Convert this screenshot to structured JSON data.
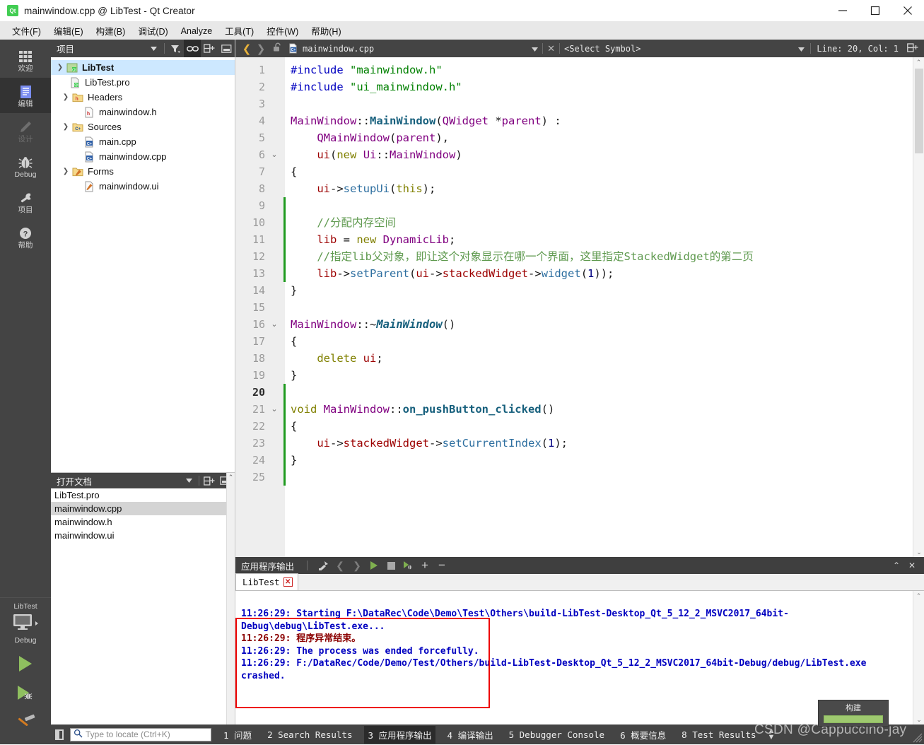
{
  "window": {
    "title": "mainwindow.cpp @ LibTest - Qt Creator",
    "logo_text": "Qt",
    "minimize": "–",
    "maximize": "□",
    "close": "✕"
  },
  "menubar": {
    "items": [
      {
        "label": "文件(F)"
      },
      {
        "label": "编辑(E)"
      },
      {
        "label": "构建(B)"
      },
      {
        "label": "调试(D)"
      },
      {
        "label": "Analyze"
      },
      {
        "label": "工具(T)"
      },
      {
        "label": "控件(W)"
      },
      {
        "label": "帮助(H)"
      }
    ]
  },
  "modebar": {
    "items": [
      {
        "label": "欢迎",
        "icon": "grid-icon",
        "state": "normal"
      },
      {
        "label": "编辑",
        "icon": "document-icon",
        "state": "active"
      },
      {
        "label": "设计",
        "icon": "pencil-icon",
        "state": "disabled"
      },
      {
        "label": "Debug",
        "icon": "bug-icon",
        "state": "normal"
      },
      {
        "label": "项目",
        "icon": "wrench-icon",
        "state": "normal"
      },
      {
        "label": "帮助",
        "icon": "question-icon",
        "state": "normal"
      }
    ]
  },
  "kit_selector": {
    "project_name": "LibTest",
    "build_config": "Debug",
    "run_button": "run-icon",
    "debug_button": "debug-run-icon",
    "build_button": "hammer-icon"
  },
  "project_panel": {
    "title": "项目",
    "toolbar": [
      {
        "name": "dropdown-arrow",
        "glyph": "▾"
      },
      {
        "name": "filter-icon",
        "glyph": "filter"
      },
      {
        "name": "link-with-editor-icon",
        "glyph": "link",
        "active": true
      },
      {
        "name": "split-icon",
        "glyph": "split"
      },
      {
        "name": "close-panel-icon",
        "glyph": "minimize"
      }
    ],
    "tree": [
      {
        "label": "LibTest",
        "depth": 0,
        "arrow": "v",
        "icon": "qt-project-icon",
        "selected": true,
        "bold": true
      },
      {
        "label": "LibTest.pro",
        "depth": 1,
        "arrow": "",
        "icon": "qt-pro-icon",
        "selected": false,
        "bold": false
      },
      {
        "label": "Headers",
        "depth": 1,
        "arrow": "v",
        "icon": "folder-h-icon",
        "selected": false,
        "bold": false
      },
      {
        "label": "mainwindow.h",
        "depth": 2,
        "arrow": "",
        "icon": "header-file-icon",
        "selected": false,
        "bold": false
      },
      {
        "label": "Sources",
        "depth": 1,
        "arrow": "v",
        "icon": "folder-cpp-icon",
        "selected": false,
        "bold": false
      },
      {
        "label": "main.cpp",
        "depth": 2,
        "arrow": "",
        "icon": "cpp-file-icon",
        "selected": false,
        "bold": false
      },
      {
        "label": "mainwindow.cpp",
        "depth": 2,
        "arrow": "",
        "icon": "cpp-file-icon",
        "selected": false,
        "bold": false
      },
      {
        "label": "Forms",
        "depth": 1,
        "arrow": "v",
        "icon": "folder-ui-icon",
        "selected": false,
        "bold": false
      },
      {
        "label": "mainwindow.ui",
        "depth": 2,
        "arrow": "",
        "icon": "ui-file-icon",
        "selected": false,
        "bold": false
      }
    ]
  },
  "open_documents": {
    "title": "打开文档",
    "items": [
      {
        "label": "LibTest.pro",
        "selected": false
      },
      {
        "label": "mainwindow.cpp",
        "selected": true
      },
      {
        "label": "mainwindow.h",
        "selected": false
      },
      {
        "label": "mainwindow.ui",
        "selected": false
      }
    ]
  },
  "editor_toolbar": {
    "back": "❬",
    "forward": "❭",
    "lock": "unlock-icon",
    "file_name": "mainwindow.cpp",
    "symbol_placeholder": "<Select Symbol>",
    "line_col": "Line: 20, Col: 1",
    "split_button": "split-editor-icon"
  },
  "editor": {
    "lines": [
      {
        "n": "1",
        "fold": "",
        "changed": false,
        "current": false,
        "tokens": [
          {
            "t": "#include ",
            "c": "t-pre"
          },
          {
            "t": "\"mainwindow.h\"",
            "c": "t-str"
          }
        ]
      },
      {
        "n": "2",
        "fold": "",
        "changed": false,
        "current": false,
        "tokens": [
          {
            "t": "#include ",
            "c": "t-pre"
          },
          {
            "t": "\"ui_mainwindow.h\"",
            "c": "t-str"
          }
        ]
      },
      {
        "n": "3",
        "fold": "",
        "changed": false,
        "current": false,
        "tokens": []
      },
      {
        "n": "4",
        "fold": "",
        "changed": false,
        "current": false,
        "tokens": [
          {
            "t": "MainWindow",
            "c": "t-cls"
          },
          {
            "t": "::",
            "c": "t-plain"
          },
          {
            "t": "MainWindow",
            "c": "t-fn"
          },
          {
            "t": "(",
            "c": "t-plain"
          },
          {
            "t": "QWidget",
            "c": "t-cls"
          },
          {
            "t": " *",
            "c": "t-plain"
          },
          {
            "t": "parent",
            "c": "t-cls"
          },
          {
            "t": ") :",
            "c": "t-plain"
          }
        ]
      },
      {
        "n": "5",
        "fold": "",
        "changed": false,
        "current": false,
        "tokens": [
          {
            "t": "    ",
            "c": "t-plain"
          },
          {
            "t": "QMainWindow",
            "c": "t-cls"
          },
          {
            "t": "(",
            "c": "t-plain"
          },
          {
            "t": "parent",
            "c": "t-cls"
          },
          {
            "t": "),",
            "c": "t-plain"
          }
        ]
      },
      {
        "n": "6",
        "fold": "v",
        "changed": false,
        "current": false,
        "tokens": [
          {
            "t": "    ",
            "c": "t-plain"
          },
          {
            "t": "ui",
            "c": "t-var"
          },
          {
            "t": "(",
            "c": "t-plain"
          },
          {
            "t": "new",
            "c": "t-kw"
          },
          {
            "t": " ",
            "c": "t-plain"
          },
          {
            "t": "Ui",
            "c": "t-cls"
          },
          {
            "t": "::",
            "c": "t-plain"
          },
          {
            "t": "MainWindow",
            "c": "t-cls"
          },
          {
            "t": ")",
            "c": "t-plain"
          }
        ]
      },
      {
        "n": "7",
        "fold": "",
        "changed": false,
        "current": false,
        "tokens": [
          {
            "t": "{",
            "c": "t-plain"
          }
        ]
      },
      {
        "n": "8",
        "fold": "",
        "changed": false,
        "current": false,
        "tokens": [
          {
            "t": "    ",
            "c": "t-plain"
          },
          {
            "t": "ui",
            "c": "t-var"
          },
          {
            "t": "->",
            "c": "t-plain"
          },
          {
            "t": "setupUi",
            "c": "t-call"
          },
          {
            "t": "(",
            "c": "t-plain"
          },
          {
            "t": "this",
            "c": "t-kw"
          },
          {
            "t": ");",
            "c": "t-plain"
          }
        ]
      },
      {
        "n": "9",
        "fold": "",
        "changed": true,
        "current": false,
        "tokens": []
      },
      {
        "n": "10",
        "fold": "",
        "changed": true,
        "current": false,
        "tokens": [
          {
            "t": "    //分配内存空间",
            "c": "t-cmt"
          }
        ]
      },
      {
        "n": "11",
        "fold": "",
        "changed": true,
        "current": false,
        "tokens": [
          {
            "t": "    ",
            "c": "t-plain"
          },
          {
            "t": "lib",
            "c": "t-var"
          },
          {
            "t": " = ",
            "c": "t-plain"
          },
          {
            "t": "new",
            "c": "t-kw"
          },
          {
            "t": " ",
            "c": "t-plain"
          },
          {
            "t": "DynamicLib",
            "c": "t-cls"
          },
          {
            "t": ";",
            "c": "t-plain"
          }
        ]
      },
      {
        "n": "12",
        "fold": "",
        "changed": true,
        "current": false,
        "tokens": [
          {
            "t": "    //指定lib父对象，即让这个对象显示在哪一个界面，这里指定StackedWidget的第二页",
            "c": "t-cmt"
          }
        ]
      },
      {
        "n": "13",
        "fold": "",
        "changed": true,
        "current": false,
        "tokens": [
          {
            "t": "    ",
            "c": "t-plain"
          },
          {
            "t": "lib",
            "c": "t-var"
          },
          {
            "t": "->",
            "c": "t-plain"
          },
          {
            "t": "setParent",
            "c": "t-call"
          },
          {
            "t": "(",
            "c": "t-plain"
          },
          {
            "t": "ui",
            "c": "t-var"
          },
          {
            "t": "->",
            "c": "t-plain"
          },
          {
            "t": "stackedWidget",
            "c": "t-var"
          },
          {
            "t": "->",
            "c": "t-plain"
          },
          {
            "t": "widget",
            "c": "t-call"
          },
          {
            "t": "(",
            "c": "t-plain"
          },
          {
            "t": "1",
            "c": "t-num"
          },
          {
            "t": "));",
            "c": "t-plain"
          }
        ]
      },
      {
        "n": "14",
        "fold": "",
        "changed": false,
        "current": false,
        "tokens": [
          {
            "t": "}",
            "c": "t-plain"
          }
        ]
      },
      {
        "n": "15",
        "fold": "",
        "changed": false,
        "current": false,
        "tokens": []
      },
      {
        "n": "16",
        "fold": "v",
        "changed": false,
        "current": false,
        "tokens": [
          {
            "t": "MainWindow",
            "c": "t-cls"
          },
          {
            "t": "::~",
            "c": "t-plain"
          },
          {
            "t": "MainWindow",
            "c": "t-fni"
          },
          {
            "t": "()",
            "c": "t-plain"
          }
        ]
      },
      {
        "n": "17",
        "fold": "",
        "changed": false,
        "current": false,
        "tokens": [
          {
            "t": "{",
            "c": "t-plain"
          }
        ]
      },
      {
        "n": "18",
        "fold": "",
        "changed": false,
        "current": false,
        "tokens": [
          {
            "t": "    ",
            "c": "t-plain"
          },
          {
            "t": "delete",
            "c": "t-kw"
          },
          {
            "t": " ",
            "c": "t-plain"
          },
          {
            "t": "ui",
            "c": "t-var"
          },
          {
            "t": ";",
            "c": "t-plain"
          }
        ]
      },
      {
        "n": "19",
        "fold": "",
        "changed": false,
        "current": false,
        "tokens": [
          {
            "t": "}",
            "c": "t-plain"
          }
        ]
      },
      {
        "n": "20",
        "fold": "",
        "changed": true,
        "current": true,
        "tokens": []
      },
      {
        "n": "21",
        "fold": "v",
        "changed": true,
        "current": false,
        "tokens": [
          {
            "t": "void",
            "c": "t-kw"
          },
          {
            "t": " ",
            "c": "t-plain"
          },
          {
            "t": "MainWindow",
            "c": "t-cls"
          },
          {
            "t": "::",
            "c": "t-plain"
          },
          {
            "t": "on_pushButton_clicked",
            "c": "t-fn"
          },
          {
            "t": "()",
            "c": "t-plain"
          }
        ]
      },
      {
        "n": "22",
        "fold": "",
        "changed": true,
        "current": false,
        "tokens": [
          {
            "t": "{",
            "c": "t-plain"
          }
        ]
      },
      {
        "n": "23",
        "fold": "",
        "changed": true,
        "current": false,
        "tokens": [
          {
            "t": "    ",
            "c": "t-plain"
          },
          {
            "t": "ui",
            "c": "t-var"
          },
          {
            "t": "->",
            "c": "t-plain"
          },
          {
            "t": "stackedWidget",
            "c": "t-var"
          },
          {
            "t": "->",
            "c": "t-plain"
          },
          {
            "t": "setCurrentIndex",
            "c": "t-call"
          },
          {
            "t": "(",
            "c": "t-plain"
          },
          {
            "t": "1",
            "c": "t-num"
          },
          {
            "t": ");",
            "c": "t-plain"
          }
        ]
      },
      {
        "n": "24",
        "fold": "",
        "changed": true,
        "current": false,
        "tokens": [
          {
            "t": "}",
            "c": "t-plain"
          }
        ]
      },
      {
        "n": "25",
        "fold": "",
        "changed": true,
        "current": false,
        "tokens": []
      }
    ]
  },
  "output_pane": {
    "title": "应用程序输出",
    "toolbar": [
      {
        "name": "clear-output-icon",
        "glyph": "broom"
      },
      {
        "name": "prev-item-icon",
        "glyph": "❬"
      },
      {
        "name": "next-item-icon",
        "glyph": "❭"
      },
      {
        "name": "run-icon",
        "glyph": "▶"
      },
      {
        "name": "stop-icon",
        "glyph": "■"
      },
      {
        "name": "attach-debugger-icon",
        "glyph": "▶bug"
      },
      {
        "name": "zoom-in-icon",
        "glyph": "+"
      },
      {
        "name": "zoom-out-icon",
        "glyph": "−"
      }
    ],
    "maximize_glyph": "⌃",
    "close_glyph": "✕",
    "tab": {
      "label": "LibTest",
      "close_glyph": "✕"
    },
    "lines": [
      {
        "text": "11:26:29: Starting F:\\DataRec\\Code\\Demo\\Test\\Others\\build-LibTest-Desktop_Qt_5_12_2_MSVC2017_64bit-Debug\\debug\\LibTest.exe...",
        "error": false
      },
      {
        "text": "11:26:29: 程序异常结束。",
        "error": true
      },
      {
        "text": "11:26:29: The process was ended forcefully.",
        "error": false
      },
      {
        "text": "11:26:29: F:/DataRec/Code/Demo/Test/Others/build-LibTest-Desktop_Qt_5_12_2_MSVC2017_64bit-Debug/debug/LibTest.exe crashed.",
        "error": false
      }
    ]
  },
  "build_popup": {
    "label": "构建",
    "progress": 100
  },
  "watermark": {
    "text": "CSDN @Cappuccino-jay"
  },
  "statusbar": {
    "locator_placeholder": "Type to locate (Ctrl+K)",
    "tabs": [
      {
        "label": "1 问题",
        "active": false
      },
      {
        "label": "2 Search Results",
        "active": false
      },
      {
        "label": "3 应用程序输出",
        "active": true
      },
      {
        "label": "4 编译输出",
        "active": false
      },
      {
        "label": "5 Debugger Console",
        "active": false
      },
      {
        "label": "6 概要信息",
        "active": false
      },
      {
        "label": "8 Test Results",
        "active": false
      }
    ]
  },
  "colors": {
    "mode_bar_bg": "#444444",
    "accent_green": "#41cd52",
    "selection_blue": "#cde8ff",
    "error_red": "#ee0000",
    "change_bar_green": "#1f9a1f"
  }
}
